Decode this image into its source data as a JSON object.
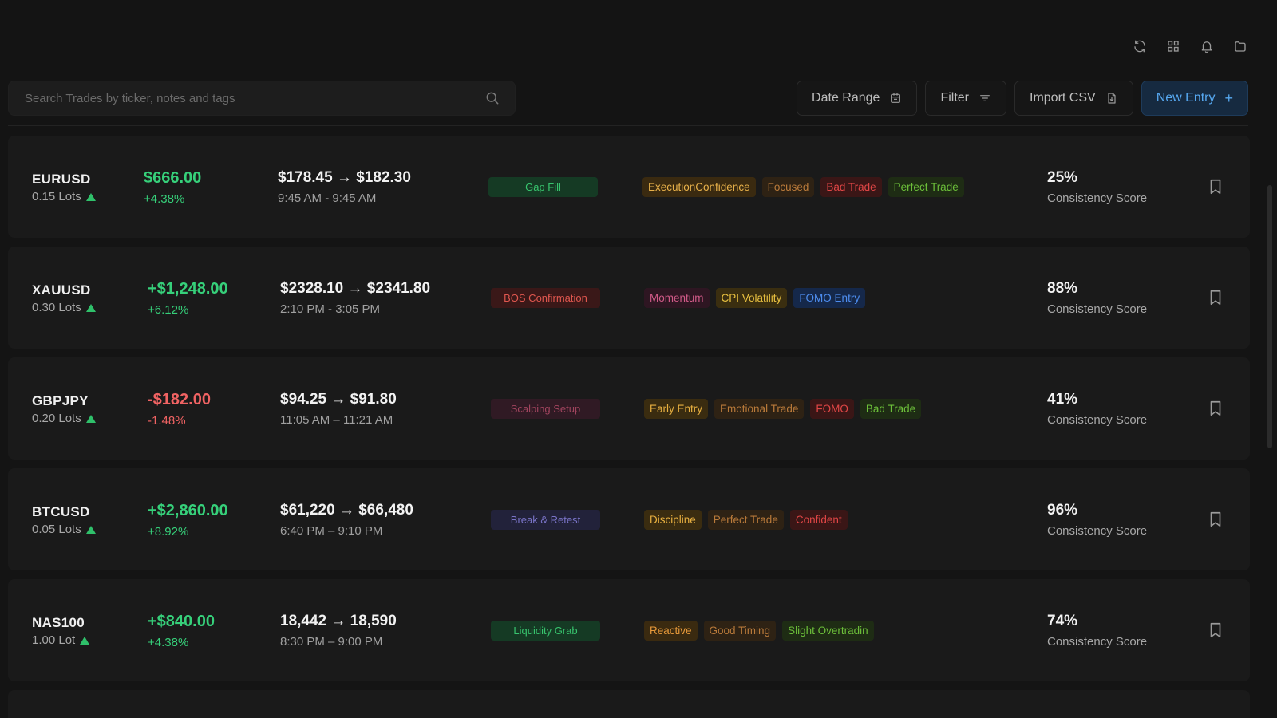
{
  "search": {
    "placeholder": "Search Trades by ticker, notes and tags"
  },
  "toolbar": {
    "date_range_label": "Date Range",
    "filter_label": "Filter",
    "import_label": "Import CSV",
    "new_entry_label": "New Entry",
    "new_entry_icon": "+"
  },
  "colors": {
    "accent": "#56a8f0",
    "positive": "#36d07a",
    "negative": "#f06363"
  },
  "trades": [
    {
      "ticker": "EURUSD",
      "lots": "0.15 Lots",
      "pnl": "$666.00",
      "pct": "+4.38%",
      "direction": "positive",
      "price_range": "$178.45 → $182.30",
      "time": "9:45 AM - 9:45 AM",
      "setup": "Gap Fill",
      "tags": [
        "ExecutionConfidence",
        "Focused",
        "Bad Trade",
        "Perfect Trade"
      ],
      "score": "25%",
      "score_label": "Consistency Score"
    },
    {
      "ticker": "XAUUSD",
      "lots": "0.30 Lots",
      "pnl": "+$1,248.00",
      "pct": "+6.12%",
      "direction": "positive",
      "price_range": "$2328.10 → $2341.80",
      "time": "2:10 PM - 3:05 PM",
      "setup": "BOS Confirmation",
      "tags": [
        "Momentum",
        "CPI Volatility",
        "FOMO Entry"
      ],
      "score": "88%",
      "score_label": "Consistency Score"
    },
    {
      "ticker": "GBPJPY",
      "lots": "0.20 Lots",
      "pnl": "-$182.00",
      "pct": "-1.48%",
      "direction": "negative",
      "price_range": "$94.25 → $91.80",
      "time": "11:05 AM – 11:21 AM",
      "setup": "Scalping Setup",
      "tags": [
        "Early Entry",
        "Emotional Trade",
        "FOMO",
        "Bad Trade"
      ],
      "score": "41%",
      "score_label": "Consistency Score"
    },
    {
      "ticker": "BTCUSD",
      "lots": "0.05 Lots",
      "pnl": "+$2,860.00",
      "pct": "+8.92%",
      "direction": "positive",
      "price_range": "$61,220 → $66,480",
      "time": "6:40 PM – 9:10 PM",
      "setup": "Break & Retest",
      "tags": [
        "Discipline",
        "Perfect Trade",
        "Confident"
      ],
      "score": "96%",
      "score_label": "Consistency Score"
    },
    {
      "ticker": "NAS100",
      "lots": "1.00 Lot",
      "pnl": "+$840.00",
      "pct": "+4.38%",
      "direction": "positive",
      "price_range": "18,442 → 18,590",
      "time": "8:30 PM – 9:00 PM",
      "setup": "Liquidity Grab",
      "tags": [
        "Reactive",
        "Good Timing",
        "Slight Overtradin"
      ],
      "score": "74%",
      "score_label": "Consistency Score"
    }
  ]
}
